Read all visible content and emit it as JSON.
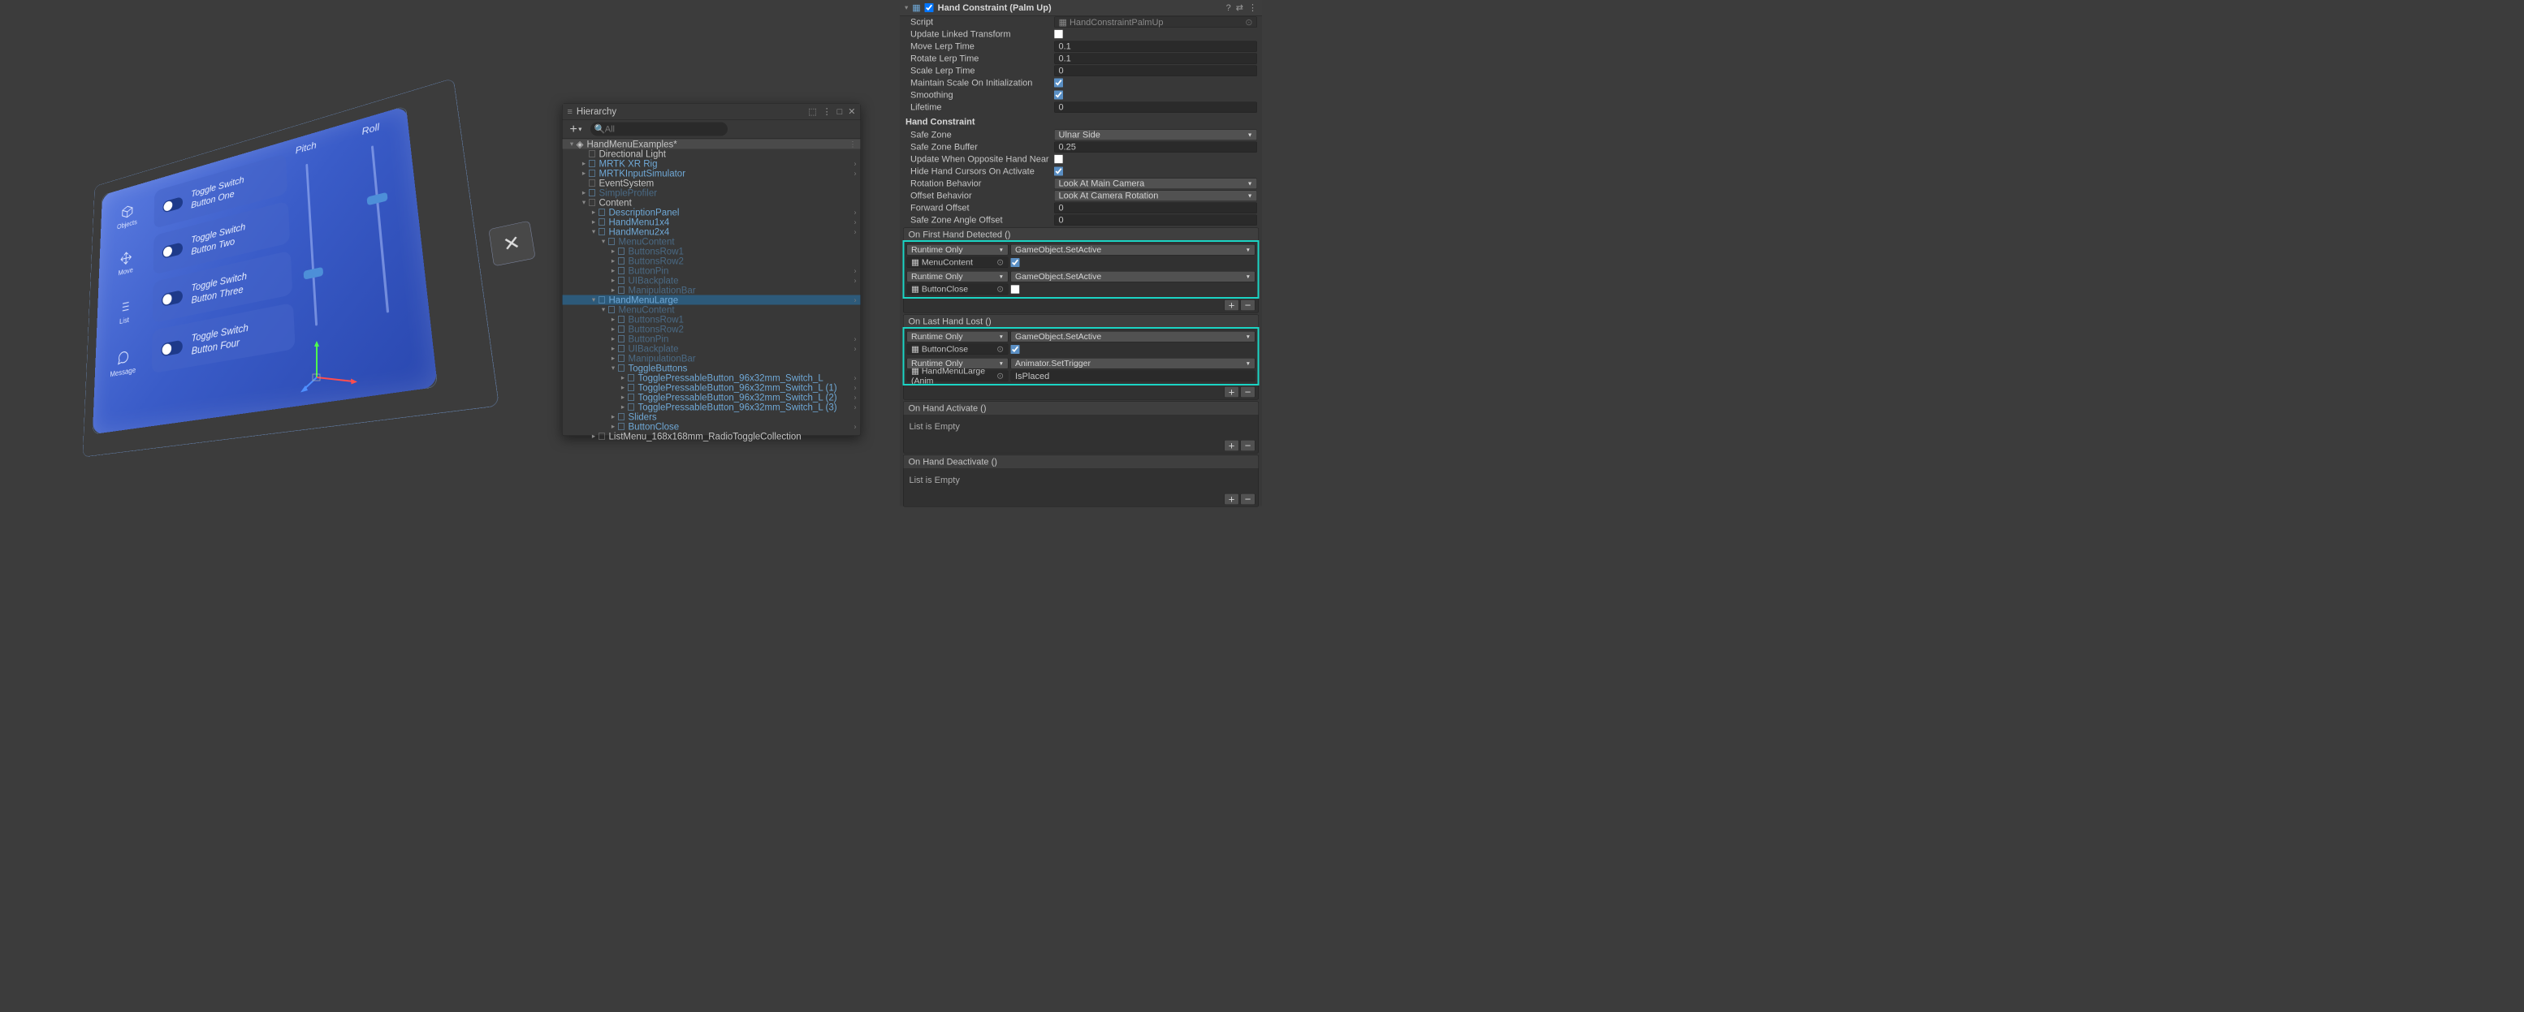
{
  "scene": {
    "sidebar": [
      {
        "icon": "objects-icon",
        "label": "Objects"
      },
      {
        "icon": "move-icon",
        "label": "Move"
      },
      {
        "icon": "list-icon",
        "label": "List"
      },
      {
        "icon": "message-icon",
        "label": "Message"
      }
    ],
    "toggles": [
      "Toggle Switch Button One",
      "Toggle Switch Button Two",
      "Toggle Switch Button Three",
      "Toggle Switch Button Four"
    ],
    "sliders": [
      "Pitch",
      "Roll"
    ]
  },
  "hierarchy": {
    "title": "Hierarchy",
    "search_placeholder": "All",
    "scene_name": "HandMenuExamples*",
    "items": [
      {
        "depth": 1,
        "fold": "",
        "name": "Directional Light",
        "style": "normal"
      },
      {
        "depth": 1,
        "fold": "▸",
        "name": "MRTK XR Rig",
        "style": "prefab",
        "arrow": true
      },
      {
        "depth": 1,
        "fold": "▸",
        "name": "MRTKInputSimulator",
        "style": "prefab",
        "arrow": true
      },
      {
        "depth": 1,
        "fold": "",
        "name": "EventSystem",
        "style": "normal"
      },
      {
        "depth": 1,
        "fold": "▸",
        "name": "SimpleProfiler",
        "style": "prefab-faded"
      },
      {
        "depth": 1,
        "fold": "▾",
        "name": "Content",
        "style": "normal"
      },
      {
        "depth": 2,
        "fold": "▸",
        "name": "DescriptionPanel",
        "style": "prefab",
        "arrow": true
      },
      {
        "depth": 2,
        "fold": "▸",
        "name": "HandMenu1x4",
        "style": "prefab",
        "arrow": true
      },
      {
        "depth": 2,
        "fold": "▾",
        "name": "HandMenu2x4",
        "style": "prefab",
        "arrow": true
      },
      {
        "depth": 3,
        "fold": "▾",
        "name": "MenuContent",
        "style": "prefab-faded"
      },
      {
        "depth": 4,
        "fold": "▸",
        "name": "ButtonsRow1",
        "style": "prefab-faded"
      },
      {
        "depth": 4,
        "fold": "▸",
        "name": "ButtonsRow2",
        "style": "prefab-faded"
      },
      {
        "depth": 4,
        "fold": "▸",
        "name": "ButtonPin",
        "style": "prefab-faded",
        "arrow": true
      },
      {
        "depth": 4,
        "fold": "▸",
        "name": "UIBackplate",
        "style": "prefab-faded",
        "arrow": true
      },
      {
        "depth": 4,
        "fold": "▸",
        "name": "ManipulationBar",
        "style": "prefab-faded"
      },
      {
        "depth": 2,
        "fold": "▾",
        "name": "HandMenuLarge",
        "style": "prefab",
        "arrow": true,
        "sel": true
      },
      {
        "depth": 3,
        "fold": "▾",
        "name": "MenuContent",
        "style": "prefab-faded"
      },
      {
        "depth": 4,
        "fold": "▸",
        "name": "ButtonsRow1",
        "style": "prefab-faded"
      },
      {
        "depth": 4,
        "fold": "▸",
        "name": "ButtonsRow2",
        "style": "prefab-faded"
      },
      {
        "depth": 4,
        "fold": "▸",
        "name": "ButtonPin",
        "style": "prefab-faded",
        "arrow": true
      },
      {
        "depth": 4,
        "fold": "▸",
        "name": "UIBackplate",
        "style": "prefab-faded",
        "arrow": true
      },
      {
        "depth": 4,
        "fold": "▸",
        "name": "ManipulationBar",
        "style": "prefab-faded"
      },
      {
        "depth": 4,
        "fold": "▾",
        "name": "ToggleButtons",
        "style": "prefab"
      },
      {
        "depth": 5,
        "fold": "▸",
        "name": "TogglePressableButton_96x32mm_Switch_L",
        "style": "prefab",
        "arrow": true
      },
      {
        "depth": 5,
        "fold": "▸",
        "name": "TogglePressableButton_96x32mm_Switch_L (1)",
        "style": "prefab",
        "arrow": true
      },
      {
        "depth": 5,
        "fold": "▸",
        "name": "TogglePressableButton_96x32mm_Switch_L (2)",
        "style": "prefab",
        "arrow": true
      },
      {
        "depth": 5,
        "fold": "▸",
        "name": "TogglePressableButton_96x32mm_Switch_L (3)",
        "style": "prefab",
        "arrow": true
      },
      {
        "depth": 4,
        "fold": "▸",
        "name": "Sliders",
        "style": "prefab"
      },
      {
        "depth": 4,
        "fold": "▸",
        "name": "ButtonClose",
        "style": "prefab",
        "arrow": true
      },
      {
        "depth": 2,
        "fold": "▸",
        "name": "ListMenu_168x168mm_RadioToggleCollection",
        "style": "normal"
      }
    ]
  },
  "inspector": {
    "component": "Hand Constraint (Palm Up)",
    "script_label": "Script",
    "script_value": "HandConstraintPalmUp",
    "props": [
      {
        "label": "Update Linked Transform",
        "type": "check",
        "value": false
      },
      {
        "label": "Move Lerp Time",
        "type": "text",
        "value": "0.1"
      },
      {
        "label": "Rotate Lerp Time",
        "type": "text",
        "value": "0.1"
      },
      {
        "label": "Scale Lerp Time",
        "type": "text",
        "value": "0"
      },
      {
        "label": "Maintain Scale On Initialization",
        "type": "check",
        "value": true
      },
      {
        "label": "Smoothing",
        "type": "check",
        "value": true
      },
      {
        "label": "Lifetime",
        "type": "text",
        "value": "0"
      }
    ],
    "section": "Hand Constraint",
    "props2": [
      {
        "label": "Safe Zone",
        "type": "dd",
        "value": "Ulnar Side"
      },
      {
        "label": "Safe Zone Buffer",
        "type": "text",
        "value": "0.25"
      },
      {
        "label": "Update When Opposite Hand Near",
        "type": "check",
        "value": false
      },
      {
        "label": "Hide Hand Cursors On Activate",
        "type": "check",
        "value": true
      },
      {
        "label": "Rotation Behavior",
        "type": "dd",
        "value": "Look At Main Camera"
      },
      {
        "label": "Offset Behavior",
        "type": "dd",
        "value": "Look At Camera Rotation"
      },
      {
        "label": "Forward Offset",
        "type": "text",
        "value": "0"
      },
      {
        "label": "Safe Zone Angle Offset",
        "type": "text",
        "value": "0"
      }
    ],
    "events": [
      {
        "title": "On First Hand Detected ()",
        "highlight": true,
        "entries": [
          {
            "mode": "Runtime Only",
            "func": "GameObject.SetActive",
            "obj": "MenuContent",
            "arg_check": true
          },
          {
            "mode": "Runtime Only",
            "func": "GameObject.SetActive",
            "obj": "ButtonClose",
            "arg_check": false
          }
        ]
      },
      {
        "title": "On Last Hand Lost ()",
        "highlight": true,
        "entries": [
          {
            "mode": "Runtime Only",
            "func": "GameObject.SetActive",
            "obj": "ButtonClose",
            "arg_check": true
          },
          {
            "mode": "Runtime Only",
            "func": "Animator.SetTrigger",
            "obj": "HandMenuLarge (Anim",
            "arg_text": "IsPlaced"
          }
        ]
      },
      {
        "title": "On Hand Activate ()",
        "empty": "List is Empty"
      },
      {
        "title": "On Hand Deactivate ()",
        "empty": "List is Empty"
      }
    ]
  }
}
